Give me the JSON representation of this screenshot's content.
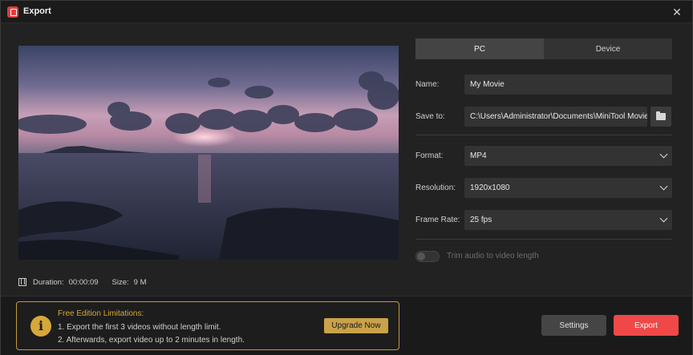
{
  "window": {
    "title": "Export",
    "app_icon": "minitool-app-icon",
    "close_icon": "close-icon"
  },
  "tabs": [
    {
      "label": "PC",
      "active": true
    },
    {
      "label": "Device",
      "active": false
    }
  ],
  "form": {
    "name": {
      "label": "Name:",
      "value": "My Movie"
    },
    "save_to": {
      "label": "Save to:",
      "value": "C:\\Users\\Administrator\\Documents\\MiniTool Movie",
      "button_icon": "folder-icon"
    },
    "format": {
      "label": "Format:",
      "value": "MP4"
    },
    "resolution": {
      "label": "Resolution:",
      "value": "1920x1080"
    },
    "frame_rate": {
      "label": "Frame Rate:",
      "value": "25 fps"
    },
    "trim_audio": {
      "label": "Trim audio to video length",
      "enabled": false
    }
  },
  "info": {
    "duration_label": "Duration:",
    "duration_value": "00:00:09",
    "size_label": "Size:",
    "size_value": "9 M"
  },
  "notice": {
    "title": "Free Edition Limitations:",
    "line1": "1. Export the first 3 videos without length limit.",
    "line2": "2. Afterwards, export video up to 2 minutes in length.",
    "upgrade_label": "Upgrade Now",
    "icon": "info-icon"
  },
  "actions": {
    "settings_label": "Settings",
    "export_label": "Export"
  },
  "colors": {
    "accent_export": "#f04848",
    "notice_gold": "#c9a24a",
    "panel": "#333333"
  }
}
